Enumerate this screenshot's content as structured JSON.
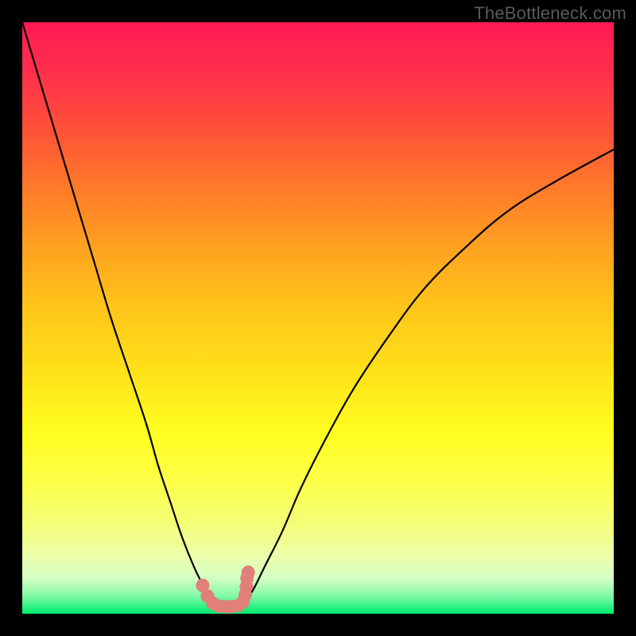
{
  "watermark": "TheBottleneck.com",
  "colors": {
    "frame": "#000000",
    "curve": "#000000",
    "marker": "#e08078",
    "gradient_top": "#ff1a53",
    "gradient_mid": "#ffe419",
    "gradient_bottom": "#05e76a"
  },
  "chart_data": {
    "type": "line",
    "title": "",
    "xlabel": "",
    "ylabel": "",
    "xlim": [
      0,
      100
    ],
    "ylim": [
      0,
      100
    ],
    "grid": false,
    "legend": false,
    "note": "Values estimated from pixel positions; axes are unlabeled in the source image. y=0 is bottom, y=100 is top.",
    "series": [
      {
        "name": "left-branch",
        "x": [
          0,
          3,
          6,
          9,
          12,
          15,
          18,
          21,
          23,
          25,
          27,
          29,
          30.5,
          32,
          33.5
        ],
        "y": [
          100,
          90,
          80,
          70,
          60,
          50,
          41,
          32,
          25,
          19,
          13,
          8,
          5,
          3,
          2
        ]
      },
      {
        "name": "right-branch",
        "x": [
          37.5,
          39,
          41,
          44,
          47,
          51,
          56,
          62,
          68,
          75,
          82,
          90,
          100
        ],
        "y": [
          2,
          4,
          8,
          14,
          21,
          29,
          38,
          47,
          55,
          62,
          68,
          73,
          78.5
        ]
      },
      {
        "name": "valley-markers",
        "style": "scatter",
        "color": "#e08078",
        "x": [
          30.5,
          31.3,
          32.2,
          33.2,
          34.3,
          35.4,
          36.5,
          37.3,
          37.7,
          37.9,
          38.0,
          38.2
        ],
        "y": [
          4.8,
          3.0,
          1.8,
          1.3,
          1.2,
          1.2,
          1.4,
          2.0,
          3.2,
          4.6,
          6.0,
          7.0
        ]
      }
    ]
  }
}
